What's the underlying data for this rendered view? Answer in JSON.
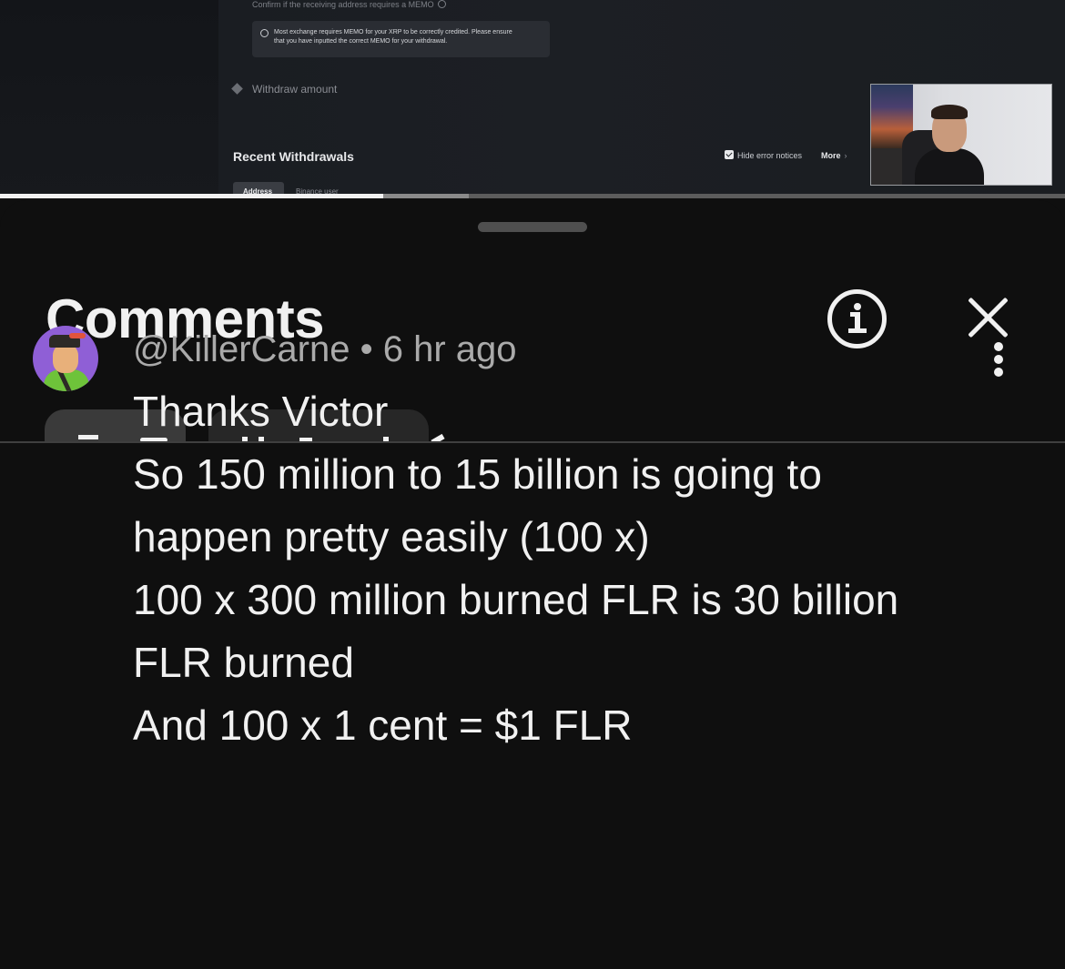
{
  "video": {
    "confirm_memo_text": "Confirm if the receiving address requires a MEMO",
    "memo_notice_line1": "Most exchange requires MEMO for your XRP to be correctly credited. Please ensure",
    "memo_notice_line2": "that you have inputted the correct MEMO for your withdrawal.",
    "withdraw_amount_label": "Withdraw amount",
    "recent_withdrawals_title": "Recent Withdrawals",
    "hide_error_notices_label": "Hide error notices",
    "more_label": "More",
    "tabs": [
      "Address",
      "Binance user"
    ],
    "progress_played_fraction": 0.36,
    "progress_buffered_fraction": 0.44
  },
  "sheet": {
    "title": "Comments"
  },
  "comment": {
    "author": "@KillerCarne",
    "separator": "•",
    "time": "6 hr ago",
    "lines": [
      "Thanks Victor",
      "So 150 million to 15 billion is going to",
      "happen pretty easily (100 x)",
      "100 x 300 million burned FLR is 30 billion",
      "FLR burned",
      "And 100 x 1 cent = $1 FLR"
    ]
  },
  "icons": {
    "info": "info-circle-icon",
    "close": "close-icon",
    "menu": "more-vertical-icon"
  },
  "colors": {
    "background": "#0f0f0f",
    "text_primary": "#f1f1f1",
    "text_secondary": "#aaaaaa",
    "avatar_bg": "#8f5fd6"
  }
}
